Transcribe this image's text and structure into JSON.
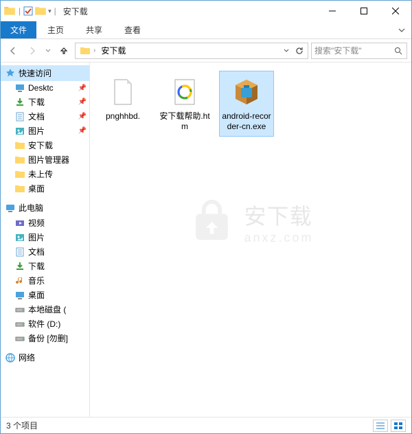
{
  "titlebar": {
    "folder_name": "安下载",
    "tooltip_min": "最小化",
    "tooltip_max": "最大化",
    "tooltip_close": "关闭"
  },
  "ribbon": {
    "file": "文件",
    "tabs": [
      "主页",
      "共享",
      "查看"
    ]
  },
  "nav": {
    "breadcrumb_root_icon": "folder",
    "breadcrumb": [
      "安下载"
    ],
    "search_placeholder": "搜索\"安下载\""
  },
  "sidebar": {
    "quick_access": {
      "label": "快速访问",
      "items": [
        {
          "label": "Desktc",
          "icon": "desktop",
          "pinned": true
        },
        {
          "label": "下载",
          "icon": "download",
          "pinned": true
        },
        {
          "label": "文档",
          "icon": "doc",
          "pinned": true
        },
        {
          "label": "图片",
          "icon": "picture",
          "pinned": true
        },
        {
          "label": "安下载",
          "icon": "folder",
          "pinned": false
        },
        {
          "label": "图片管理器",
          "icon": "folder",
          "pinned": false
        },
        {
          "label": "未上传",
          "icon": "folder",
          "pinned": false
        },
        {
          "label": "桌面",
          "icon": "folder",
          "pinned": false
        }
      ]
    },
    "this_pc": {
      "label": "此电脑",
      "items": [
        {
          "label": "视频",
          "icon": "video"
        },
        {
          "label": "图片",
          "icon": "picture"
        },
        {
          "label": "文档",
          "icon": "doc"
        },
        {
          "label": "下载",
          "icon": "download"
        },
        {
          "label": "音乐",
          "icon": "music"
        },
        {
          "label": "桌面",
          "icon": "desktop"
        },
        {
          "label": "本地磁盘 (",
          "icon": "drive"
        },
        {
          "label": "软件 (D:)",
          "icon": "drive"
        },
        {
          "label": "备份 [勿删]",
          "icon": "drive"
        }
      ]
    },
    "network": {
      "label": "网络"
    }
  },
  "files": [
    {
      "name": "pnghhbd.",
      "type": "file",
      "selected": false
    },
    {
      "name": "安下载帮助.htm",
      "type": "htm",
      "selected": false
    },
    {
      "name": "android-recorder-cn.exe",
      "type": "exe",
      "selected": true
    }
  ],
  "status": {
    "item_count_text": "3 个项目"
  },
  "watermark": {
    "main": "安下载",
    "sub": "anxz.com"
  }
}
